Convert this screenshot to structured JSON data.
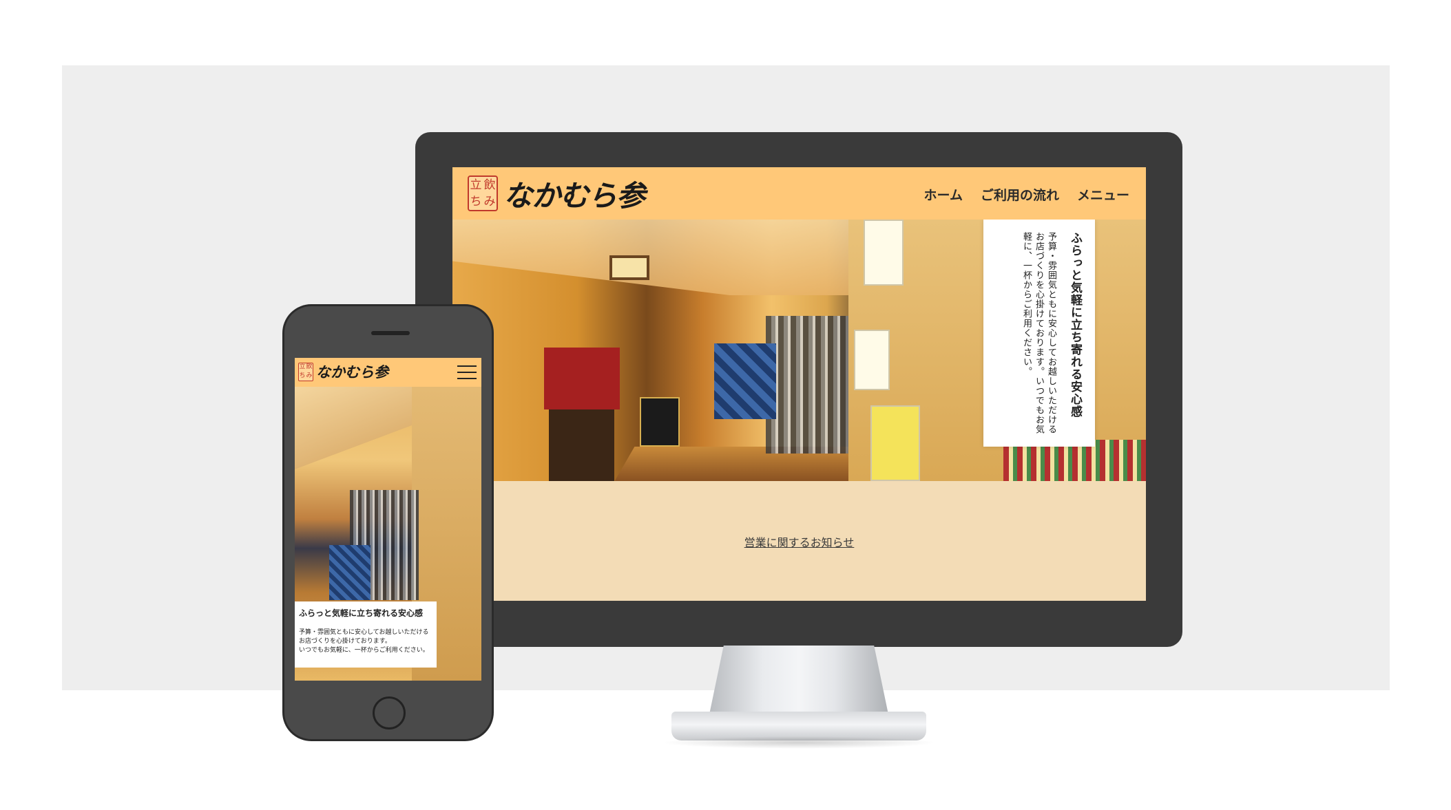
{
  "brand": {
    "seal_chars": [
      "立",
      "飲",
      "ち",
      "み"
    ],
    "name": "なかむら参",
    "accent_color": "#ffc878",
    "seal_color": "#c0392b",
    "notice_bg": "#f3dcb6"
  },
  "desktop": {
    "nav": [
      "ホーム",
      "ご利用の流れ",
      "メニュー"
    ],
    "hero_card": {
      "title": "ふらっと気軽に立ち寄れる安心感",
      "body": "予算・雰囲気ともに安心してお越しいただけるお店づくりを心掛けております。いつでもお気軽に、一杯からご利用ください。"
    },
    "notice_link": "営業に関するお知らせ"
  },
  "mobile": {
    "menu_icon": "hamburger-icon",
    "hero_card": {
      "title": "ふらっと気軽に立ち寄れる安心感",
      "body_lines": [
        "予算・雰囲気ともに安心してお越しいただける",
        "お店づくりを心掛けております。",
        "いつでもお気軽に、一杯からご利用ください。"
      ]
    }
  }
}
